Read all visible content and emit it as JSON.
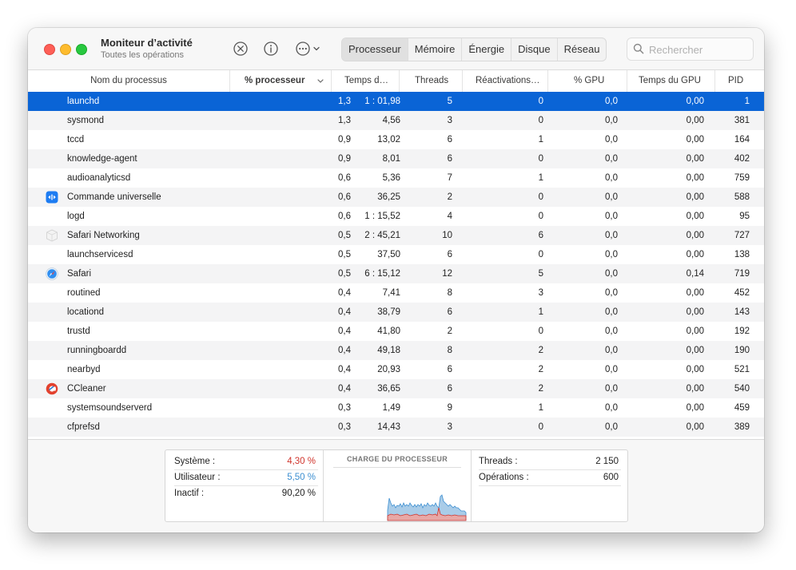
{
  "window": {
    "title": "Moniteur d’activité",
    "subtitle": "Toutes les opérations"
  },
  "toolbar": {
    "stop_icon": "stop-process-icon",
    "info_icon": "info-icon",
    "more_icon": "more-options-icon",
    "tabs": [
      {
        "label": "Processeur",
        "active": true
      },
      {
        "label": "Mémoire",
        "active": false
      },
      {
        "label": "Énergie",
        "active": false
      },
      {
        "label": "Disque",
        "active": false
      },
      {
        "label": "Réseau",
        "active": false
      }
    ],
    "search_placeholder": "Rechercher"
  },
  "columns": {
    "name": "Nom du processus",
    "cpu": "% processeur",
    "time": "Temps d…",
    "threads": "Threads",
    "wakeups": "Réactivations…",
    "gpu": "% GPU",
    "gpu_time": "Temps du GPU",
    "pid": "PID"
  },
  "rows": [
    {
      "icon": "",
      "name": "launchd",
      "cpu": "1,3",
      "time": "1 : 01,98",
      "threads": "5",
      "wakeups": "0",
      "gpu": "0,0",
      "gpu_time": "0,00",
      "pid": "1",
      "selected": true
    },
    {
      "icon": "",
      "name": "sysmond",
      "cpu": "1,3",
      "time": "4,56",
      "threads": "3",
      "wakeups": "0",
      "gpu": "0,0",
      "gpu_time": "0,00",
      "pid": "381"
    },
    {
      "icon": "",
      "name": "tccd",
      "cpu": "0,9",
      "time": "13,02",
      "threads": "6",
      "wakeups": "1",
      "gpu": "0,0",
      "gpu_time": "0,00",
      "pid": "164"
    },
    {
      "icon": "",
      "name": "knowledge-agent",
      "cpu": "0,9",
      "time": "8,01",
      "threads": "6",
      "wakeups": "0",
      "gpu": "0,0",
      "gpu_time": "0,00",
      "pid": "402"
    },
    {
      "icon": "",
      "name": "audioanalyticsd",
      "cpu": "0,6",
      "time": "5,36",
      "threads": "7",
      "wakeups": "1",
      "gpu": "0,0",
      "gpu_time": "0,00",
      "pid": "759"
    },
    {
      "icon": "universal-control-icon",
      "name": "Commande universelle",
      "cpu": "0,6",
      "time": "36,25",
      "threads": "2",
      "wakeups": "0",
      "gpu": "0,0",
      "gpu_time": "0,00",
      "pid": "588"
    },
    {
      "icon": "",
      "name": "logd",
      "cpu": "0,6",
      "time": "1 : 15,52",
      "threads": "4",
      "wakeups": "0",
      "gpu": "0,0",
      "gpu_time": "0,00",
      "pid": "95"
    },
    {
      "icon": "safari-networking-icon",
      "name": "Safari Networking",
      "cpu": "0,5",
      "time": "2 : 45,21",
      "threads": "10",
      "wakeups": "6",
      "gpu": "0,0",
      "gpu_time": "0,00",
      "pid": "727"
    },
    {
      "icon": "",
      "name": "launchservicesd",
      "cpu": "0,5",
      "time": "37,50",
      "threads": "6",
      "wakeups": "0",
      "gpu": "0,0",
      "gpu_time": "0,00",
      "pid": "138"
    },
    {
      "icon": "safari-icon",
      "name": "Safari",
      "cpu": "0,5",
      "time": "6 : 15,12",
      "threads": "12",
      "wakeups": "5",
      "gpu": "0,0",
      "gpu_time": "0,14",
      "pid": "719"
    },
    {
      "icon": "",
      "name": "routined",
      "cpu": "0,4",
      "time": "7,41",
      "threads": "8",
      "wakeups": "3",
      "gpu": "0,0",
      "gpu_time": "0,00",
      "pid": "452"
    },
    {
      "icon": "",
      "name": "locationd",
      "cpu": "0,4",
      "time": "38,79",
      "threads": "6",
      "wakeups": "1",
      "gpu": "0,0",
      "gpu_time": "0,00",
      "pid": "143"
    },
    {
      "icon": "",
      "name": "trustd",
      "cpu": "0,4",
      "time": "41,80",
      "threads": "2",
      "wakeups": "0",
      "gpu": "0,0",
      "gpu_time": "0,00",
      "pid": "192"
    },
    {
      "icon": "",
      "name": "runningboardd",
      "cpu": "0,4",
      "time": "49,18",
      "threads": "8",
      "wakeups": "2",
      "gpu": "0,0",
      "gpu_time": "0,00",
      "pid": "190"
    },
    {
      "icon": "",
      "name": "nearbyd",
      "cpu": "0,4",
      "time": "20,93",
      "threads": "6",
      "wakeups": "2",
      "gpu": "0,0",
      "gpu_time": "0,00",
      "pid": "521"
    },
    {
      "icon": "ccleaner-icon",
      "name": "CCleaner",
      "cpu": "0,4",
      "time": "36,65",
      "threads": "6",
      "wakeups": "2",
      "gpu": "0,0",
      "gpu_time": "0,00",
      "pid": "540"
    },
    {
      "icon": "",
      "name": "systemsoundserverd",
      "cpu": "0,3",
      "time": "1,49",
      "threads": "9",
      "wakeups": "1",
      "gpu": "0,0",
      "gpu_time": "0,00",
      "pid": "459"
    },
    {
      "icon": "",
      "name": "cfprefsd",
      "cpu": "0,3",
      "time": "14,43",
      "threads": "3",
      "wakeups": "0",
      "gpu": "0,0",
      "gpu_time": "0,00",
      "pid": "389"
    }
  ],
  "footer": {
    "system_label": "Système :",
    "system_value": "4,30 %",
    "user_label": "Utilisateur :",
    "user_value": "5,50 %",
    "idle_label": "Inactif :",
    "idle_value": "90,20 %",
    "chart_title": "CHARGE DU PROCESSEUR",
    "threads_label": "Threads :",
    "threads_value": "2 150",
    "ops_label": "Opérations :",
    "ops_value": "600"
  },
  "colors": {
    "selection": "#0a64d6",
    "system": "#d0342c",
    "user": "#3d8fd1"
  }
}
